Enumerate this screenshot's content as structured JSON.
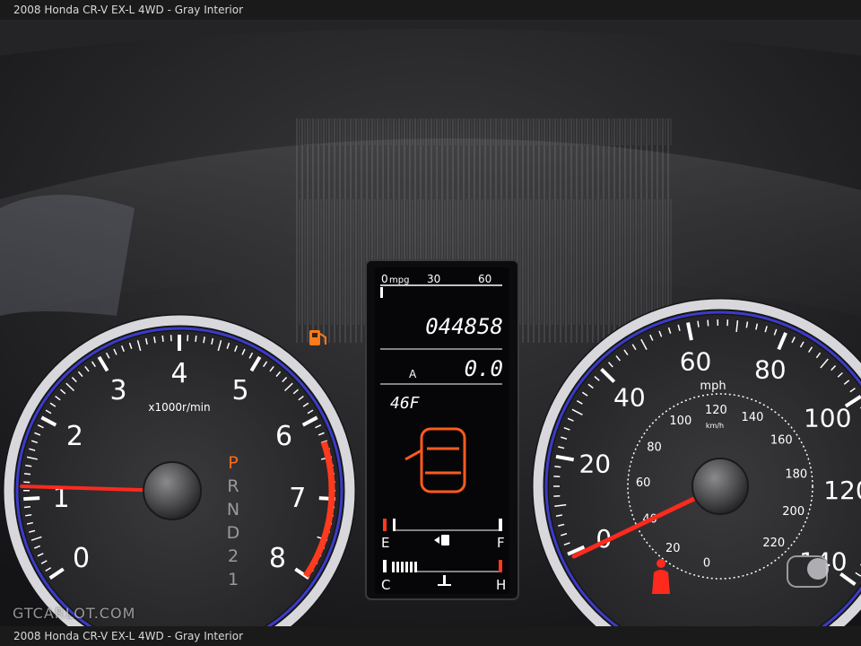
{
  "caption": {
    "top": "2008 Honda CR-V EX-L 4WD - Gray Interior",
    "bottom": "2008 Honda CR-V EX-L 4WD - Gray Interior"
  },
  "watermark": "GTCARLOT.COM",
  "tachometer": {
    "numbers": [
      "0",
      "1",
      "2",
      "3",
      "4",
      "5",
      "6",
      "7",
      "8"
    ],
    "unit": "x1000r/min",
    "gears": [
      "P",
      "R",
      "N",
      "D",
      "2",
      "1"
    ]
  },
  "display": {
    "mpg_scale": [
      "0",
      "mpg",
      "30",
      "60"
    ],
    "odometer": "044858",
    "trip_label": "A",
    "trip_value": "0.0",
    "temperature": "46F",
    "fuel_empty": "E",
    "fuel_full": "F",
    "temp_cold": "C",
    "temp_hot": "H"
  },
  "speedometer": {
    "mph_numbers": [
      "0",
      "20",
      "40",
      "60",
      "80",
      "100",
      "120",
      "140"
    ],
    "mph_unit": "mph",
    "kmh_numbers": [
      "0",
      "20",
      "40",
      "60",
      "80",
      "100",
      "120",
      "140",
      "160",
      "180",
      "200",
      "220"
    ],
    "kmh_unit": "km/h"
  },
  "colors": {
    "gauge_face": "#2b2b2e",
    "bezel_ring": "#d8d8dc",
    "inner_ring": "#3b3cc8",
    "tick": "#ffffff",
    "needle": "#ff2a1e",
    "lcd_text": "#ffffff",
    "warning": "#ff6a1a"
  }
}
